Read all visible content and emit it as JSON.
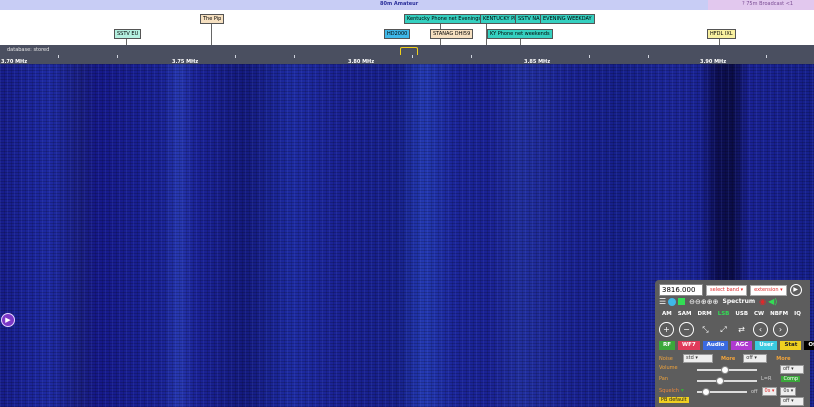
{
  "band": {
    "label": "80m Amateur",
    "right_label": "? 75m Broadcast <1"
  },
  "stations": [
    {
      "name": "The Pip",
      "color": "#f6e0c0"
    },
    {
      "name": "Kentucky Phone net Evenings",
      "color": "#35d0c0"
    },
    {
      "name": "KENTUCKY PHONE",
      "color": "#35d0c0"
    },
    {
      "name": "SSTV NA",
      "color": "#35d0c0"
    },
    {
      "name": "EVENING WEEKDAY",
      "color": "#35d0c0"
    },
    {
      "name": "SSTV EU",
      "color": "#b5f0e0"
    },
    {
      "name": "HD2000",
      "color": "#3fb8e8"
    },
    {
      "name": "STANAG DHI59",
      "color": "#f6e0c0"
    },
    {
      "name": "KY Phone net weekends",
      "color": "#35d0c0"
    },
    {
      "name": "HFDL IXL",
      "color": "#f8f0a0"
    }
  ],
  "ruler": {
    "database": "database: stored",
    "freqs": [
      "3.70 MHz",
      "3.75 MHz",
      "3.80 MHz",
      "3.85 MHz",
      "3.90 MHz"
    ]
  },
  "panel": {
    "frequency": "3816.000",
    "select_band": "select band",
    "extension": "extension",
    "spectrum": "Spectrum",
    "modes": [
      "AM",
      "SAM",
      "DRM",
      "LSB",
      "USB",
      "CW",
      "NBFM",
      "IQ"
    ],
    "active_mode": "LSB",
    "tabs": [
      "RF",
      "WF7",
      "Audio",
      "AGC",
      "User",
      "Stat",
      "Off"
    ],
    "noise_label": "Noise",
    "noise_value": "std",
    "more_label": "More",
    "noise_off": "off",
    "more2": "More",
    "volume_label": "Volume",
    "volume_sel": "off",
    "volume_level": 0.6,
    "pan_label": "Pan",
    "lr_label": "L=R",
    "comp_label": "Comp",
    "squelch_label": "Squelch",
    "squelch_off": "off",
    "squelch_v1": "0s",
    "squelch_v2": "0s",
    "pb_default": "PB default",
    "pb_sel": "off"
  },
  "colors": {
    "active": "#33dd55",
    "accent": "#f2a43a"
  }
}
